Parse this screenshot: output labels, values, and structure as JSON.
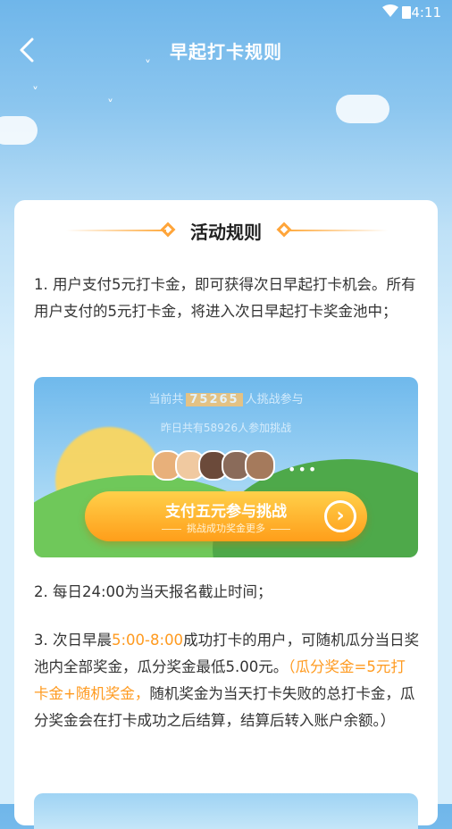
{
  "status": {
    "time": "4:11"
  },
  "navbar": {
    "title": "早起打卡规则"
  },
  "section": {
    "title": "活动规则"
  },
  "rules": {
    "rule1": "1. 用户支付5元打卡金，即可获得次日早起打卡机会。所有用户支付的5元打卡金，将进入次日早起打卡奖金池中；",
    "rule2": "2. 每日24:00为当天报名截止时间；",
    "rule3": {
      "p1": "3. 次日早晨",
      "time_range": "5:00-8:00",
      "p2": "成功打卡的用户，可随机瓜分当日奖池内全部奖金，瓜分奖金最低5.00元。",
      "highlight": "（瓜分奖金=5元打卡金+随机奖金，",
      "p3": "随机奖金为当天打卡失败的总打卡金，瓜分奖金会在打卡成功之后结算，结算后转入账户余额。）"
    }
  },
  "banner": {
    "count_prefix": "当前共",
    "count_value": "75265",
    "count_suffix": "人挑战参与",
    "yesterday": "昨日共有58926人参加挑战",
    "dots": "•••",
    "button_label": "支付五元参与挑战",
    "button_sub": "挑战成功奖金更多",
    "avatar_colors": [
      "#e8b07a",
      "#f0c9a0",
      "#6b4a3a",
      "#8a6b5a",
      "#a57a5c"
    ]
  },
  "colors": {
    "accent": "#ff9a1f",
    "button": "#ffb12e"
  }
}
